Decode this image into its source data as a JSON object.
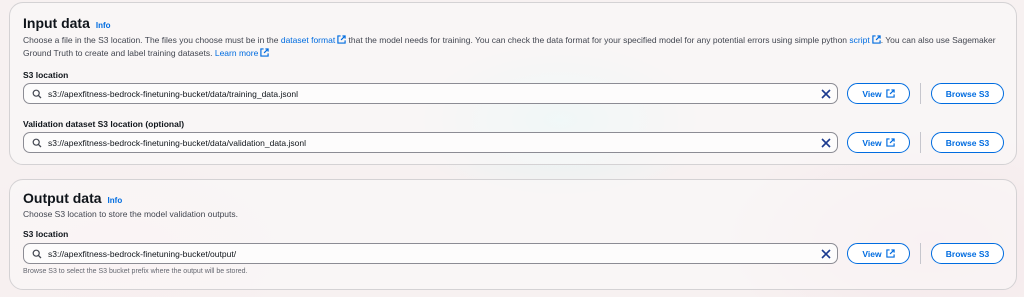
{
  "input_data": {
    "title": "Input data",
    "info": "Info",
    "desc_part1": "Choose a file in the S3 location. The files you choose must be in the ",
    "desc_link1": "dataset format",
    "desc_part2": " that the model needs for training. You can check the data format for your specified model for any potential errors using simple python ",
    "desc_link2": "script",
    "desc_part3": ". You can also use Sagemaker Ground Truth to create and label training datasets. ",
    "desc_link3": "Learn more",
    "s3_label": "S3 location",
    "s3_value": "s3://apexfitness-bedrock-finetuning-bucket/data/training_data.jsonl",
    "validation_label": "Validation dataset S3 location (optional)",
    "validation_value": "s3://apexfitness-bedrock-finetuning-bucket/data/validation_data.jsonl"
  },
  "output_data": {
    "title": "Output data",
    "info": "Info",
    "desc": "Choose S3 location to store the model validation outputs.",
    "s3_label": "S3 location",
    "s3_value": "s3://apexfitness-bedrock-finetuning-bucket/output/",
    "hint": "Browse S3 to select the S3 bucket prefix where the output will be stored."
  },
  "buttons": {
    "view": "View",
    "browse": "Browse S3"
  },
  "icons": {
    "search": "search-icon",
    "clear": "close-icon",
    "external": "external-link-icon"
  },
  "colors": {
    "accent": "#006ce0",
    "text": "#0f141a",
    "muted": "#424650"
  }
}
